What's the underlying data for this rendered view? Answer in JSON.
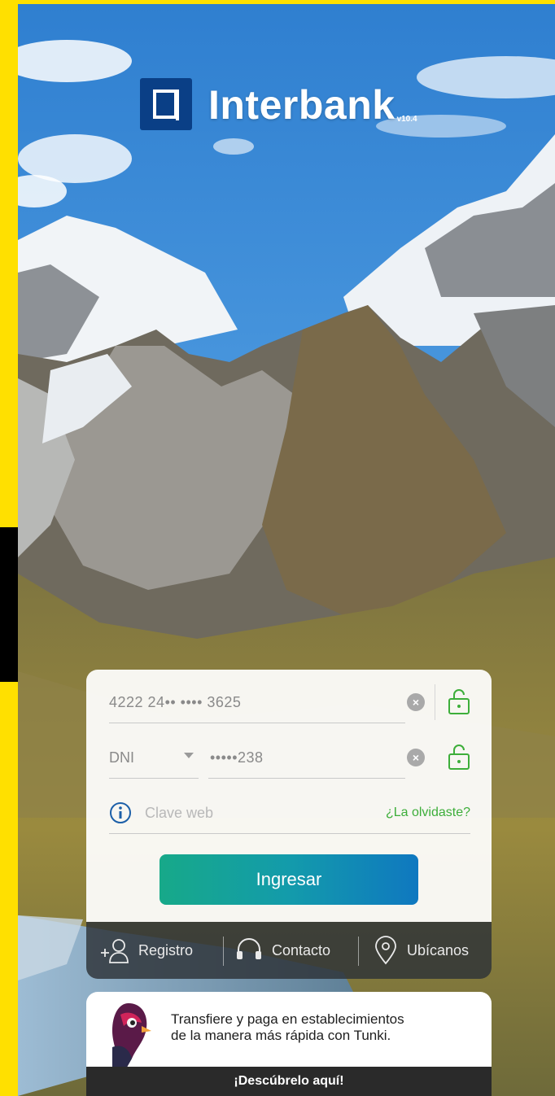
{
  "app": {
    "brand": "Interbank",
    "version": "v10.4",
    "brand_color": "#0A3F86"
  },
  "login": {
    "card_number": "4222 24•• •••• 3625",
    "doc_type": "DNI",
    "doc_number": "•••••238",
    "password_placeholder": "Clave web",
    "forgot_label": "¿La olvidaste?",
    "submit_label": "Ingresar"
  },
  "bottom_nav": {
    "items": [
      {
        "label": "Registro",
        "icon": "add-user-icon"
      },
      {
        "label": "Contacto",
        "icon": "headset-icon"
      },
      {
        "label": "Ubícanos",
        "icon": "location-pin-icon"
      }
    ]
  },
  "promo": {
    "text_line1": "Transfiere y paga en establecimientos",
    "text_line2": "de la manera más rápida con Tunki.",
    "cta": "¡Descúbrelo aquí!",
    "icon": "tunki-bird-icon"
  },
  "colors": {
    "frame": "#FFE000",
    "accent_green": "#3DAE3A",
    "button_start": "#17A989",
    "button_end": "#0F78C0"
  }
}
